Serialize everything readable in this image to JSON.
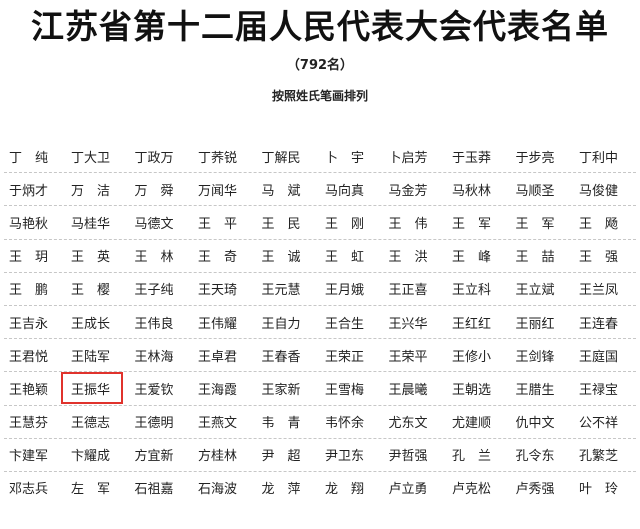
{
  "title": "江苏省第十二届人民代表大会代表名单",
  "count": "（792名）",
  "subtitle": "按照姓氏笔画排列",
  "highlight_name": "王振华",
  "rows": [
    [
      "丁　纯",
      "丁大卫",
      "丁政万",
      "丁荞锐",
      "丁解民",
      "卜　宇",
      "卜启芳",
      "于玉莽",
      "于步亮",
      "丁利中"
    ],
    [
      "于炳才",
      "万　洁",
      "万　舜",
      "万闻华",
      "马　斌",
      "马向真",
      "马金芳",
      "马秋林",
      "马顺圣",
      "马俊健"
    ],
    [
      "马艳秋",
      "马桂华",
      "马德文",
      "王　平",
      "王　民",
      "王　刚",
      "王　伟",
      "王　军",
      "王　军",
      "王　飏"
    ],
    [
      "王　玥",
      "王　英",
      "王　林",
      "王　奇",
      "王　诚",
      "王　虹",
      "王　洪",
      "王　峰",
      "王　喆",
      "王　强"
    ],
    [
      "王　鹏",
      "王　樱",
      "王子纯",
      "王天琦",
      "王元慧",
      "王月娥",
      "王正喜",
      "王立科",
      "王立斌",
      "王兰凤"
    ],
    [
      "王吉永",
      "王成长",
      "王伟良",
      "王伟耀",
      "王自力",
      "王合生",
      "王兴华",
      "王红红",
      "王丽红",
      "王连春"
    ],
    [
      "王君悦",
      "王陆军",
      "王林海",
      "王卓君",
      "王春香",
      "王荣正",
      "王荣平",
      "王修小",
      "王剑锋",
      "王庭国"
    ],
    [
      "王艳颖",
      "王振华",
      "王爱钦",
      "王海霞",
      "王家新",
      "王雪梅",
      "王晨曦",
      "王朝选",
      "王腊生",
      "王禄宝"
    ],
    [
      "王慧芬",
      "王德志",
      "王德明",
      "王燕文",
      "韦　青",
      "韦怀余",
      "尤东文",
      "尤建顺",
      "仇中文",
      "公不祥"
    ],
    [
      "卞建军",
      "卞耀成",
      "方宜新",
      "方桂林",
      "尹　超",
      "尹卫东",
      "尹哲强",
      "孔　兰",
      "孔令东",
      "孔繁芝"
    ],
    [
      "邓志兵",
      "左　军",
      "石祖嘉",
      "石海波",
      "龙　萍",
      "龙　翔",
      "卢立勇",
      "卢克松",
      "卢秀强",
      "叶　玲"
    ]
  ]
}
